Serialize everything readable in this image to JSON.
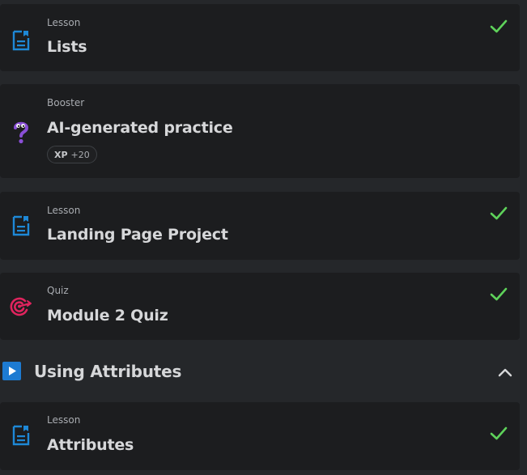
{
  "items": [
    {
      "kind": "Lesson",
      "title": "Lists",
      "icon": "lesson-document-icon",
      "completed": true
    },
    {
      "kind": "Booster",
      "title": "AI-generated practice",
      "icon": "question-mark-booster-icon",
      "completed": false,
      "xp_label": "XP",
      "xp_value": "+20"
    },
    {
      "kind": "Lesson",
      "title": "Landing Page Project",
      "icon": "lesson-document-icon",
      "completed": true
    },
    {
      "kind": "Quiz",
      "title": "Module 2 Quiz",
      "icon": "target-icon",
      "completed": true
    }
  ],
  "section": {
    "title": "Using Attributes",
    "icon": "play-icon",
    "expanded": true
  },
  "section_items": [
    {
      "kind": "Lesson",
      "title": "Attributes",
      "icon": "lesson-document-icon",
      "completed": true
    }
  ],
  "colors": {
    "background": "#25272a",
    "card": "#1c1d1f",
    "lesson_icon": "#1e88d6",
    "check": "#5ed25a",
    "quiz_icon": "#e0245e",
    "booster_icon": "#8a4fd6",
    "play_icon_bg": "#1d7bd2"
  }
}
